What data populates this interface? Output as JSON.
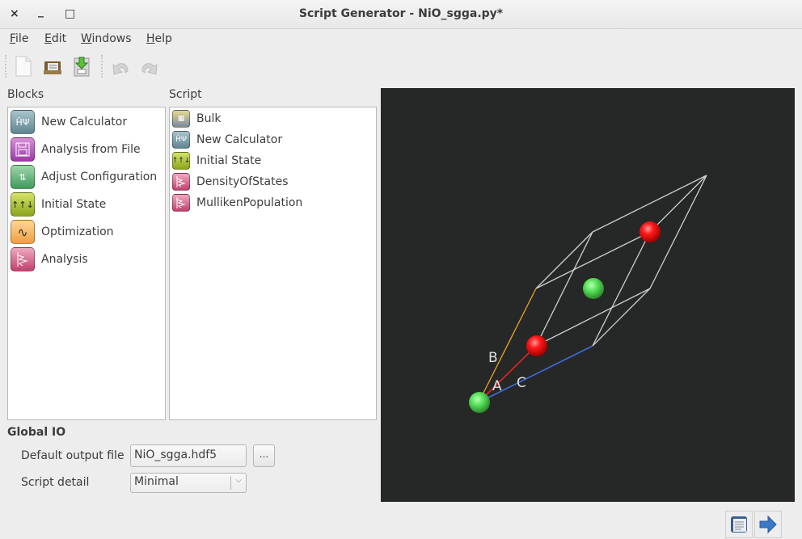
{
  "window": {
    "title": "Script Generator - NiO_sgga.py*",
    "controls": {
      "close": "×",
      "minimize": "_",
      "maximize": "□"
    }
  },
  "menubar": {
    "items": [
      {
        "label": "File",
        "mnemonic": "F",
        "rest": "ile"
      },
      {
        "label": "Edit",
        "mnemonic": "E",
        "rest": "dit"
      },
      {
        "label": "Windows",
        "mnemonic": "W",
        "rest": "indows"
      },
      {
        "label": "Help",
        "mnemonic": "H",
        "rest": "elp"
      }
    ]
  },
  "toolbar": {
    "buttons": [
      "new-file-icon",
      "open-folder-icon",
      "save-install-icon",
      "undo-icon",
      "redo-icon"
    ]
  },
  "blocks": {
    "title": "Blocks",
    "items": [
      {
        "label": "New Calculator",
        "icon": "hamiltonian-icon",
        "glyph": "ĤΨ"
      },
      {
        "label": "Analysis from File",
        "icon": "floppy-disk-icon",
        "glyph": "💾"
      },
      {
        "label": "Adjust Configuration",
        "icon": "sliders-icon",
        "glyph": "⇅"
      },
      {
        "label": "Initial State",
        "icon": "spin-arrows-icon",
        "glyph": "↑↑↓"
      },
      {
        "label": "Optimization",
        "icon": "optimization-curve-icon",
        "glyph": "∿"
      },
      {
        "label": "Analysis",
        "icon": "spectrum-icon",
        "glyph": "⋀"
      }
    ]
  },
  "script": {
    "title": "Script",
    "items": [
      {
        "label": "Bulk",
        "icon": "bulk-crystal-icon",
        "glyph": "▦"
      },
      {
        "label": "New Calculator",
        "icon": "hamiltonian-icon",
        "glyph": "ĤΨ"
      },
      {
        "label": "Initial State",
        "icon": "spin-arrows-icon",
        "glyph": "↑↑↓"
      },
      {
        "label": "DensityOfStates",
        "icon": "spectrum-icon",
        "glyph": "⋀"
      },
      {
        "label": "MullikenPopulation",
        "icon": "spectrum-icon",
        "glyph": "⋀"
      }
    ]
  },
  "global_io": {
    "title": "Global IO",
    "output_file_label": "Default output file",
    "output_file_value": "NiO_sgga.hdf5",
    "browse_label": "...",
    "script_detail_label": "Script detail",
    "script_detail_value": "Minimal"
  },
  "viewer": {
    "axis_labels": {
      "a": "A",
      "b": "B",
      "c": "C"
    },
    "colors": {
      "background": "#262727",
      "ni_atom": "#4cd64c",
      "o_atom": "#ff1a1a",
      "axis_a": "#e02020",
      "axis_b": "#f0a020",
      "axis_c": "#3a6fe0",
      "cell_edge": "#d0d0d0"
    },
    "atoms": [
      {
        "element": "Ni",
        "label": "ni-atom"
      },
      {
        "element": "O",
        "label": "o-atom"
      },
      {
        "element": "Ni",
        "label": "ni-atom"
      },
      {
        "element": "O",
        "label": "o-atom"
      }
    ]
  },
  "bottom_buttons": [
    "script-editor-icon",
    "send-arrow-icon"
  ]
}
